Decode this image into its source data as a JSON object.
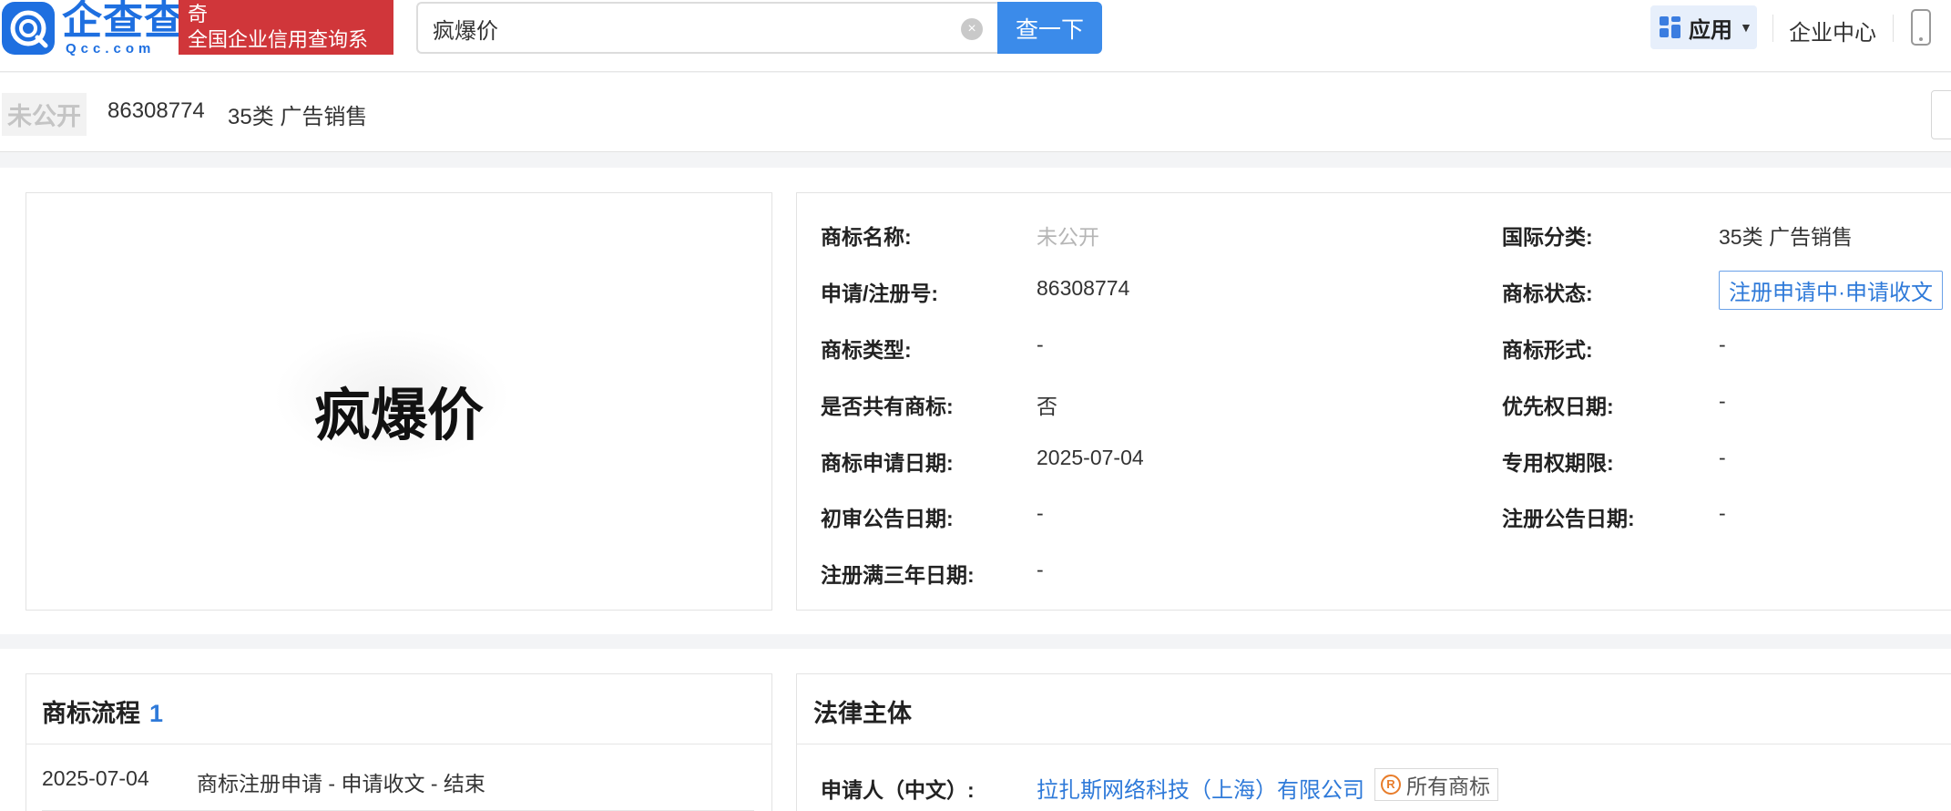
{
  "header": {
    "logo_text": "企查查",
    "logo_sub": "Qcc.com",
    "slogan_line1": "奇",
    "slogan_line2": "全国企业信用查询系",
    "search_value": "疯爆价",
    "search_button": "查一下",
    "app_button": "应用",
    "enterprise_center": "企业中心"
  },
  "subbar": {
    "name_badge": "未公开",
    "reg_no": "86308774",
    "category": "35类 广告销售"
  },
  "trademark_image": {
    "text": "疯爆价"
  },
  "details": {
    "left": [
      {
        "label": "商标名称:",
        "value": "未公开"
      },
      {
        "label": "申请/注册号:",
        "value": "86308774"
      },
      {
        "label": "商标类型:",
        "value": "-"
      },
      {
        "label": "是否共有商标:",
        "value": "否"
      },
      {
        "label": "商标申请日期:",
        "value": "2025-07-04"
      },
      {
        "label": "初审公告日期:",
        "value": "-"
      },
      {
        "label": "注册满三年日期:",
        "value": "-"
      }
    ],
    "right": [
      {
        "label": "国际分类:",
        "value": "35类 广告销售"
      },
      {
        "label": "商标状态:",
        "value": "注册申请中·申请收文"
      },
      {
        "label": "商标形式:",
        "value": "-"
      },
      {
        "label": "优先权日期:",
        "value": "-"
      },
      {
        "label": "专用权期限:",
        "value": "-"
      },
      {
        "label": "注册公告日期:",
        "value": "-"
      }
    ]
  },
  "flow": {
    "title": "商标流程",
    "count": "1",
    "items": [
      {
        "date": "2025-07-04",
        "desc": "商标注册申请 - 申请收文 - 结束"
      }
    ]
  },
  "legal": {
    "title": "法律主体",
    "applicant_label": "申请人（中文）:",
    "applicant_name": "拉扎斯网络科技（上海）有限公司",
    "all_trademarks": "所有商标",
    "r_mark": "R"
  },
  "colors": {
    "brand_blue": "#1e6fe0",
    "search_button": "#3b8bea",
    "slogan_red": "#d0363a",
    "link_blue": "#2f7ad9"
  }
}
